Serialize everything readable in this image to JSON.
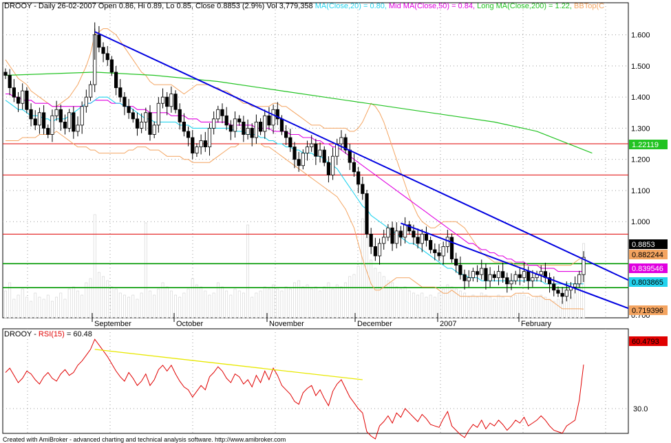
{
  "price_header": {
    "symbol": "DROOY",
    "segments": [
      {
        "text": "DROOY - Daily 26-02-2007 Open 0.86, Hi 0.89, Lo 0.85, Close 0.8853 (2.9%) Vol 3,779,358 ",
        "color": "#000000"
      },
      {
        "text": "MA(Close,20) = 0.80, ",
        "color": "#22d3ee"
      },
      {
        "text": "Mid MA(Close,50) = 0.84, ",
        "color": "#e000e0"
      },
      {
        "text": "Long MA(Close,200) = 1.22, ",
        "color": "#22c322"
      },
      {
        "text": "BBTop(C",
        "color": "#f4a460"
      }
    ]
  },
  "rsi_header": {
    "segments": [
      {
        "text": "DROOY - ",
        "color": "#000000"
      },
      {
        "text": "RSI(15)",
        "color": "#e00000"
      },
      {
        "text": " = 60.48",
        "color": "#000000"
      }
    ]
  },
  "footer": "Created with AmiBroker - advanced charting and technical analysis software. http://www.amibroker.com",
  "colors": {
    "ma20": "#22d3ee",
    "ma50": "#e000e0",
    "ma200": "#22c322",
    "bollinger": "#f4a460",
    "rsi": "#e00000",
    "trendline": "#0000e0",
    "rsi_trendline": "#e8e800",
    "hline_red": "#e00000",
    "hline_green": "#009900"
  },
  "chart_data": [
    {
      "type": "candlestick",
      "title": "DROOY - Daily 26-02-2007",
      "x_labels": [
        "September",
        "October",
        "November",
        "December",
        "2007",
        "February"
      ],
      "ylim": [
        0.7,
        1.65
      ],
      "y_ticks": [
        1.6,
        1.5,
        1.4,
        1.3,
        1.2,
        1.1,
        1.0
      ],
      "y_ticks_display": [
        "1.600",
        "1.500",
        "1.400",
        "1.300",
        "1.200",
        "1.100",
        "1.000",
        "0.700"
      ],
      "price_badges": [
        {
          "value": "1.22119",
          "bg": "#22c322",
          "fg": "#ffffff",
          "y": 1.2212
        },
        {
          "value": "0.8853",
          "bg": "#000000",
          "fg": "#ffffff",
          "y": 0.8853
        },
        {
          "value": "0.882244",
          "bg": "#f4a460",
          "fg": "#000000",
          "y": 0.8822
        },
        {
          "value": "0.839546",
          "bg": "#e000e0",
          "fg": "#ffffff",
          "y": 0.8395
        },
        {
          "value": "0.803865",
          "bg": "#22d3ee",
          "fg": "#000000",
          "y": 0.8039
        },
        {
          "value": "0.719396",
          "bg": "#f4a460",
          "fg": "#000000",
          "y": 0.7194
        }
      ],
      "horizontal_lines": [
        {
          "y": 1.25,
          "color": "red"
        },
        {
          "y": 1.15,
          "color": "red"
        },
        {
          "y": 0.96,
          "color": "red"
        },
        {
          "y": 0.865,
          "color": "green"
        },
        {
          "y": 0.788,
          "color": "green"
        }
      ],
      "close": [
        1.47,
        1.43,
        1.4,
        1.38,
        1.42,
        1.36,
        1.33,
        1.31,
        1.35,
        1.3,
        1.28,
        1.34,
        1.36,
        1.32,
        1.3,
        1.35,
        1.29,
        1.31,
        1.37,
        1.4,
        1.44,
        1.6,
        1.56,
        1.54,
        1.52,
        1.48,
        1.43,
        1.4,
        1.37,
        1.35,
        1.33,
        1.3,
        1.32,
        1.35,
        1.28,
        1.31,
        1.38,
        1.4,
        1.37,
        1.41,
        1.36,
        1.32,
        1.29,
        1.27,
        1.22,
        1.24,
        1.26,
        1.24,
        1.3,
        1.33,
        1.36,
        1.34,
        1.31,
        1.29,
        1.33,
        1.32,
        1.28,
        1.3,
        1.27,
        1.32,
        1.29,
        1.34,
        1.31,
        1.36,
        1.33,
        1.29,
        1.27,
        1.24,
        1.2,
        1.18,
        1.22,
        1.24,
        1.25,
        1.21,
        1.23,
        1.19,
        1.15,
        1.21,
        1.25,
        1.27,
        1.23,
        1.19,
        1.16,
        1.12,
        1.09,
        0.96,
        0.92,
        0.89,
        0.93,
        0.95,
        0.98,
        0.93,
        0.97,
        0.95,
        0.99,
        0.97,
        0.95,
        0.93,
        0.96,
        0.94,
        0.91,
        0.9,
        0.89,
        0.92,
        0.95,
        0.88,
        0.86,
        0.83,
        0.81,
        0.82,
        0.84,
        0.83,
        0.85,
        0.81,
        0.83,
        0.82,
        0.84,
        0.82,
        0.8,
        0.81,
        0.83,
        0.82,
        0.84,
        0.81,
        0.82,
        0.83,
        0.84,
        0.82,
        0.8,
        0.78,
        0.77,
        0.76,
        0.78,
        0.79,
        0.8,
        0.83,
        0.8853
      ],
      "ma20": [
        1.39,
        1.38,
        1.37,
        1.36,
        1.36,
        1.35,
        1.34,
        1.34,
        1.34,
        1.33,
        1.33,
        1.32,
        1.33,
        1.33,
        1.33,
        1.34,
        1.35,
        1.36,
        1.37,
        1.38,
        1.38,
        1.39,
        1.4,
        1.4,
        1.4,
        1.39,
        1.38,
        1.38,
        1.37,
        1.37,
        1.36,
        1.35,
        1.34,
        1.33,
        1.33,
        1.32,
        1.32,
        1.32,
        1.32,
        1.32,
        1.32,
        1.31,
        1.31,
        1.31,
        1.3,
        1.3,
        1.3,
        1.3,
        1.3,
        1.3,
        1.3,
        1.3,
        1.3,
        1.3,
        1.29,
        1.29,
        1.29,
        1.28,
        1.28,
        1.28,
        1.27,
        1.27,
        1.26,
        1.26,
        1.25,
        1.25,
        1.24,
        1.24,
        1.23,
        1.23,
        1.22,
        1.22,
        1.22,
        1.21,
        1.21,
        1.2,
        1.19,
        1.18,
        1.17,
        1.15,
        1.13,
        1.11,
        1.09,
        1.07,
        1.05,
        1.04,
        1.02,
        1.01,
        1.0,
        0.99,
        0.98,
        0.97,
        0.96,
        0.95,
        0.94,
        0.93,
        0.93,
        0.92,
        0.91,
        0.9,
        0.89,
        0.88,
        0.87,
        0.86,
        0.85,
        0.85,
        0.84,
        0.83,
        0.83,
        0.82,
        0.82,
        0.82,
        0.81,
        0.81,
        0.81,
        0.81,
        0.81,
        0.81,
        0.81,
        0.81,
        0.81,
        0.81,
        0.81,
        0.81,
        0.81,
        0.81,
        0.81,
        0.8,
        0.8,
        0.8,
        0.8,
        0.8,
        0.8,
        0.8,
        0.8,
        0.8,
        0.8
      ],
      "ma50": [
        1.41,
        1.41,
        1.4,
        1.4,
        1.39,
        1.39,
        1.39,
        1.38,
        1.38,
        1.38,
        1.38,
        1.37,
        1.37,
        1.37,
        1.37,
        1.37,
        1.37,
        1.37,
        1.37,
        1.38,
        1.38,
        1.39,
        1.39,
        1.39,
        1.39,
        1.38,
        1.38,
        1.38,
        1.37,
        1.37,
        1.37,
        1.36,
        1.36,
        1.36,
        1.35,
        1.35,
        1.35,
        1.35,
        1.35,
        1.34,
        1.34,
        1.34,
        1.34,
        1.33,
        1.33,
        1.33,
        1.32,
        1.32,
        1.32,
        1.32,
        1.32,
        1.32,
        1.32,
        1.31,
        1.31,
        1.31,
        1.31,
        1.31,
        1.31,
        1.3,
        1.3,
        1.3,
        1.3,
        1.29,
        1.29,
        1.29,
        1.29,
        1.28,
        1.28,
        1.28,
        1.27,
        1.27,
        1.27,
        1.26,
        1.26,
        1.25,
        1.25,
        1.24,
        1.24,
        1.23,
        1.22,
        1.21,
        1.2,
        1.19,
        1.18,
        1.17,
        1.16,
        1.15,
        1.14,
        1.13,
        1.12,
        1.11,
        1.1,
        1.09,
        1.08,
        1.07,
        1.06,
        1.05,
        1.04,
        1.03,
        1.02,
        1.01,
        1.0,
        0.99,
        0.98,
        0.97,
        0.96,
        0.95,
        0.94,
        0.93,
        0.93,
        0.92,
        0.91,
        0.91,
        0.9,
        0.9,
        0.89,
        0.89,
        0.88,
        0.88,
        0.87,
        0.87,
        0.87,
        0.86,
        0.86,
        0.86,
        0.85,
        0.85,
        0.85,
        0.85,
        0.84,
        0.84,
        0.84,
        0.84,
        0.84,
        0.84,
        0.84
      ],
      "ma200_points": [
        [
          0,
          1.47
        ],
        [
          21,
          1.48
        ],
        [
          35,
          1.47
        ],
        [
          50,
          1.45
        ],
        [
          65,
          1.42
        ],
        [
          85,
          1.38
        ],
        [
          100,
          1.35
        ],
        [
          115,
          1.32
        ],
        [
          125,
          1.29
        ],
        [
          138,
          1.22
        ]
      ],
      "bb_upper": [
        1.52,
        1.5,
        1.48,
        1.46,
        1.45,
        1.44,
        1.42,
        1.41,
        1.4,
        1.39,
        1.38,
        1.37,
        1.37,
        1.38,
        1.39,
        1.4,
        1.42,
        1.44,
        1.47,
        1.5,
        1.54,
        1.6,
        1.61,
        1.62,
        1.62,
        1.61,
        1.6,
        1.58,
        1.56,
        1.54,
        1.52,
        1.5,
        1.48,
        1.47,
        1.45,
        1.44,
        1.44,
        1.44,
        1.44,
        1.44,
        1.43,
        1.42,
        1.41,
        1.42,
        1.43,
        1.44,
        1.44,
        1.44,
        1.44,
        1.43,
        1.43,
        1.42,
        1.42,
        1.41,
        1.4,
        1.39,
        1.38,
        1.38,
        1.37,
        1.37,
        1.37,
        1.37,
        1.37,
        1.38,
        1.38,
        1.37,
        1.37,
        1.36,
        1.35,
        1.34,
        1.33,
        1.32,
        1.31,
        1.31,
        1.31,
        1.3,
        1.3,
        1.3,
        1.3,
        1.3,
        1.3,
        1.29,
        1.29,
        1.3,
        1.32,
        1.35,
        1.38,
        1.37,
        1.35,
        1.32,
        1.28,
        1.24,
        1.2,
        1.16,
        1.12,
        1.08,
        1.05,
        1.02,
        1.0,
        0.99,
        0.98,
        0.98,
        0.99,
        1.0,
        1.0,
        1.0,
        1.0,
        0.99,
        0.98,
        0.96,
        0.94,
        0.92,
        0.9,
        0.89,
        0.88,
        0.87,
        0.87,
        0.87,
        0.87,
        0.87,
        0.86,
        0.86,
        0.86,
        0.86,
        0.86,
        0.86,
        0.86,
        0.86,
        0.86,
        0.86,
        0.86,
        0.86,
        0.86,
        0.86,
        0.87,
        0.88,
        0.8822
      ],
      "bb_lower": [
        1.26,
        1.26,
        1.26,
        1.26,
        1.27,
        1.27,
        1.27,
        1.27,
        1.28,
        1.28,
        1.28,
        1.28,
        1.29,
        1.28,
        1.27,
        1.26,
        1.25,
        1.24,
        1.24,
        1.24,
        1.23,
        1.23,
        1.22,
        1.22,
        1.22,
        1.22,
        1.22,
        1.22,
        1.22,
        1.23,
        1.23,
        1.24,
        1.24,
        1.24,
        1.23,
        1.23,
        1.23,
        1.22,
        1.21,
        1.21,
        1.21,
        1.21,
        1.2,
        1.2,
        1.19,
        1.19,
        1.19,
        1.19,
        1.19,
        1.2,
        1.21,
        1.22,
        1.23,
        1.24,
        1.24,
        1.25,
        1.25,
        1.25,
        1.25,
        1.25,
        1.25,
        1.24,
        1.24,
        1.23,
        1.22,
        1.21,
        1.2,
        1.19,
        1.18,
        1.17,
        1.16,
        1.15,
        1.14,
        1.13,
        1.12,
        1.11,
        1.1,
        1.09,
        1.08,
        1.06,
        1.04,
        1.01,
        0.98,
        0.93,
        0.88,
        0.84,
        0.8,
        0.78,
        0.78,
        0.79,
        0.8,
        0.81,
        0.82,
        0.82,
        0.82,
        0.82,
        0.81,
        0.8,
        0.79,
        0.79,
        0.79,
        0.79,
        0.78,
        0.77,
        0.77,
        0.78,
        0.77,
        0.76,
        0.76,
        0.76,
        0.76,
        0.76,
        0.76,
        0.76,
        0.76,
        0.76,
        0.76,
        0.76,
        0.76,
        0.76,
        0.77,
        0.77,
        0.77,
        0.77,
        0.76,
        0.76,
        0.76,
        0.75,
        0.75,
        0.74,
        0.73,
        0.72,
        0.72,
        0.72,
        0.72,
        0.72,
        0.7194
      ],
      "volume": [
        26,
        30,
        18,
        22,
        28,
        20,
        16,
        24,
        20,
        18,
        22,
        16,
        20,
        24,
        18,
        28,
        30,
        26,
        22,
        34,
        38,
        56,
        44,
        40,
        36,
        30,
        28,
        24,
        22,
        20,
        22,
        18,
        24,
        30,
        26,
        22,
        28,
        34,
        30,
        26,
        22,
        20,
        24,
        28,
        38,
        32,
        30,
        26,
        22,
        24,
        34,
        30,
        26,
        22,
        28,
        26,
        24,
        22,
        20,
        24,
        26,
        30,
        28,
        32,
        28,
        26,
        30,
        28,
        34,
        36,
        30,
        32,
        28,
        30,
        26,
        30,
        34,
        28,
        32,
        30,
        34,
        40,
        42,
        50,
        52,
        62,
        56,
        48,
        44,
        40,
        36,
        34,
        30,
        28,
        30,
        26,
        24,
        22,
        24,
        20,
        22,
        20,
        24,
        28,
        32,
        30,
        28,
        26,
        24,
        20,
        22,
        20,
        24,
        22,
        20,
        18,
        22,
        20,
        18,
        20,
        22,
        24,
        22,
        20,
        18,
        20,
        22,
        20,
        18,
        16,
        18,
        16,
        18,
        20,
        24,
        34,
        28
      ],
      "volume_spikes": {
        "1": 34,
        "21": 100,
        "33": 92,
        "57": 90,
        "84": 96,
        "85": 78,
        "136": 72
      },
      "trendlines": [
        {
          "from": [
            21,
            1.61
          ],
          "to": [
            139,
            0.86
          ]
        },
        {
          "from": [
            93,
            0.995
          ],
          "to": [
            139,
            0.76
          ]
        }
      ]
    },
    {
      "type": "line",
      "title": "DROOY - RSI(15) = 60.48",
      "series": [
        {
          "name": "RSI(15)",
          "last": 60.4793
        }
      ],
      "y_ticks": [
        30.0
      ],
      "last_badge": "60.4793",
      "values": [
        55,
        58,
        53,
        48,
        51,
        56,
        54,
        50,
        47,
        52,
        55,
        51,
        49,
        54,
        57,
        53,
        55,
        60,
        63,
        67,
        71,
        78,
        74,
        70,
        66,
        61,
        56,
        52,
        49,
        55,
        51,
        46,
        49,
        54,
        46,
        50,
        57,
        60,
        56,
        60,
        54,
        49,
        45,
        43,
        38,
        42,
        46,
        43,
        52,
        55,
        59,
        56,
        51,
        48,
        54,
        52,
        47,
        50,
        45,
        53,
        48,
        56,
        50,
        58,
        53,
        46,
        43,
        40,
        35,
        33,
        41,
        44,
        46,
        39,
        43,
        37,
        32,
        42,
        47,
        50,
        44,
        38,
        34,
        30,
        27,
        14,
        11,
        9,
        18,
        21,
        25,
        20,
        27,
        24,
        30,
        27,
        24,
        21,
        26,
        23,
        19,
        18,
        17,
        23,
        28,
        18,
        15,
        12,
        10,
        15,
        19,
        17,
        22,
        16,
        20,
        18,
        22,
        19,
        15,
        18,
        22,
        20,
        24,
        18,
        20,
        22,
        25,
        22,
        18,
        15,
        14,
        13,
        18,
        20,
        22,
        36,
        60.48
      ],
      "rsi_ylim": [
        10,
        80
      ],
      "trendline": {
        "from": [
          21,
          71
        ],
        "to": [
          84,
          50
        ]
      }
    }
  ]
}
